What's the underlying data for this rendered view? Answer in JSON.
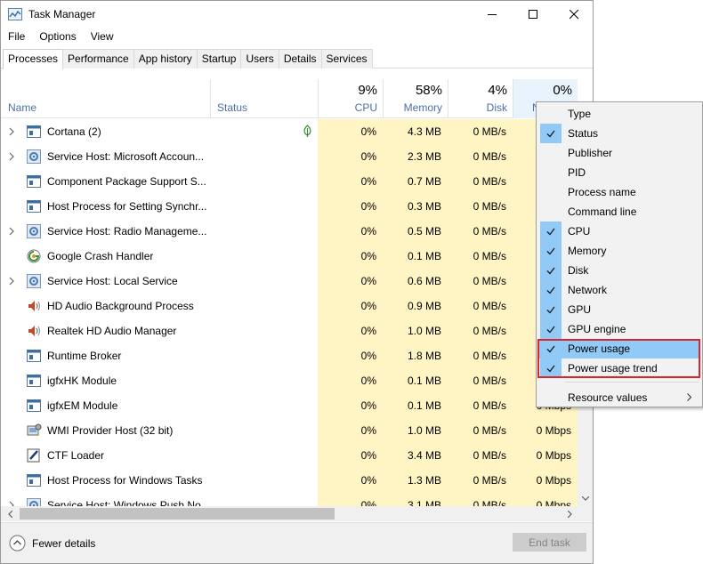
{
  "window": {
    "title": "Task Manager"
  },
  "menu": [
    "File",
    "Options",
    "View"
  ],
  "tabs": [
    {
      "label": "Processes",
      "active": true
    },
    {
      "label": "Performance"
    },
    {
      "label": "App history"
    },
    {
      "label": "Startup"
    },
    {
      "label": "Users"
    },
    {
      "label": "Details"
    },
    {
      "label": "Services"
    }
  ],
  "columns": {
    "name": "Name",
    "status": "Status",
    "cpu": {
      "pct": "9%",
      "label": "CPU"
    },
    "memory": {
      "pct": "58%",
      "label": "Memory"
    },
    "disk": {
      "pct": "4%",
      "label": "Disk"
    },
    "network": {
      "pct": "0%",
      "label": "N"
    }
  },
  "processes": [
    {
      "name": "Cortana (2)",
      "expandable": true,
      "icon": "cortana-icon",
      "leaf": true,
      "cpu": "0%",
      "mem": "4.3 MB",
      "disk": "0 MB/s",
      "net": ""
    },
    {
      "name": "Service Host: Microsoft Accoun...",
      "expandable": true,
      "icon": "gear-icon",
      "cpu": "0%",
      "mem": "2.3 MB",
      "disk": "0 MB/s",
      "net": ""
    },
    {
      "name": "Component Package Support S...",
      "expandable": false,
      "icon": "window-icon",
      "cpu": "0%",
      "mem": "0.7 MB",
      "disk": "0 MB/s",
      "net": ""
    },
    {
      "name": "Host Process for Setting Synchr...",
      "expandable": false,
      "icon": "window-icon",
      "cpu": "0%",
      "mem": "0.3 MB",
      "disk": "0 MB/s",
      "net": ""
    },
    {
      "name": "Service Host: Radio Manageme...",
      "expandable": true,
      "icon": "gear-icon",
      "cpu": "0%",
      "mem": "0.5 MB",
      "disk": "0 MB/s",
      "net": ""
    },
    {
      "name": "Google Crash Handler",
      "expandable": false,
      "icon": "google-icon",
      "cpu": "0%",
      "mem": "0.1 MB",
      "disk": "0 MB/s",
      "net": ""
    },
    {
      "name": "Service Host: Local Service",
      "expandable": true,
      "icon": "gear-icon",
      "cpu": "0%",
      "mem": "0.6 MB",
      "disk": "0 MB/s",
      "net": ""
    },
    {
      "name": "HD Audio Background Process",
      "expandable": false,
      "icon": "speaker-icon",
      "cpu": "0%",
      "mem": "0.9 MB",
      "disk": "0 MB/s",
      "net": ""
    },
    {
      "name": "Realtek HD Audio Manager",
      "expandable": false,
      "icon": "speaker-icon",
      "cpu": "0%",
      "mem": "1.0 MB",
      "disk": "0 MB/s",
      "net": ""
    },
    {
      "name": "Runtime Broker",
      "expandable": false,
      "icon": "window-icon",
      "cpu": "0%",
      "mem": "1.8 MB",
      "disk": "0 MB/s",
      "net": ""
    },
    {
      "name": "igfxHK Module",
      "expandable": false,
      "icon": "window-icon",
      "cpu": "0%",
      "mem": "0.1 MB",
      "disk": "0 MB/s",
      "net": ""
    },
    {
      "name": "igfxEM Module",
      "expandable": false,
      "icon": "window-icon",
      "cpu": "0%",
      "mem": "0.1 MB",
      "disk": "0 MB/s",
      "net": "0 Mbps"
    },
    {
      "name": "WMI Provider Host (32 bit)",
      "expandable": false,
      "icon": "wmi-icon",
      "cpu": "0%",
      "mem": "1.0 MB",
      "disk": "0 MB/s",
      "net": "0 Mbps"
    },
    {
      "name": "CTF Loader",
      "expandable": false,
      "icon": "pen-icon",
      "cpu": "0%",
      "mem": "3.4 MB",
      "disk": "0 MB/s",
      "net": "0 Mbps"
    },
    {
      "name": "Host Process for Windows Tasks",
      "expandable": false,
      "icon": "window-icon",
      "cpu": "0%",
      "mem": "1.3 MB",
      "disk": "0 MB/s",
      "net": "0 Mbps"
    },
    {
      "name": "Service Host: Windows Push No...",
      "expandable": true,
      "icon": "gear-icon",
      "cpu": "0%",
      "mem": "3.1 MB",
      "disk": "0 MB/s",
      "net": "0 Mbps"
    }
  ],
  "context_menu": {
    "items": [
      {
        "label": "Type",
        "checked": false
      },
      {
        "label": "Status",
        "checked": true
      },
      {
        "label": "Publisher",
        "checked": false
      },
      {
        "label": "PID",
        "checked": false
      },
      {
        "label": "Process name",
        "checked": false
      },
      {
        "label": "Command line",
        "checked": false
      },
      {
        "label": "CPU",
        "checked": true
      },
      {
        "label": "Memory",
        "checked": true
      },
      {
        "label": "Disk",
        "checked": true
      },
      {
        "label": "Network",
        "checked": true
      },
      {
        "label": "GPU",
        "checked": true
      },
      {
        "label": "GPU engine",
        "checked": true
      },
      {
        "label": "Power usage",
        "checked": true,
        "highlighted": true
      },
      {
        "label": "Power usage trend",
        "checked": true
      }
    ],
    "submenu": {
      "label": "Resource values"
    }
  },
  "footer": {
    "fewer_details": "Fewer details",
    "end_task": "End task"
  },
  "colors": {
    "column_highlight": "#fff4c4",
    "menu_check": "#91c9f7",
    "annotation_box": "#d9262c",
    "header_label": "#4a6fa5"
  }
}
